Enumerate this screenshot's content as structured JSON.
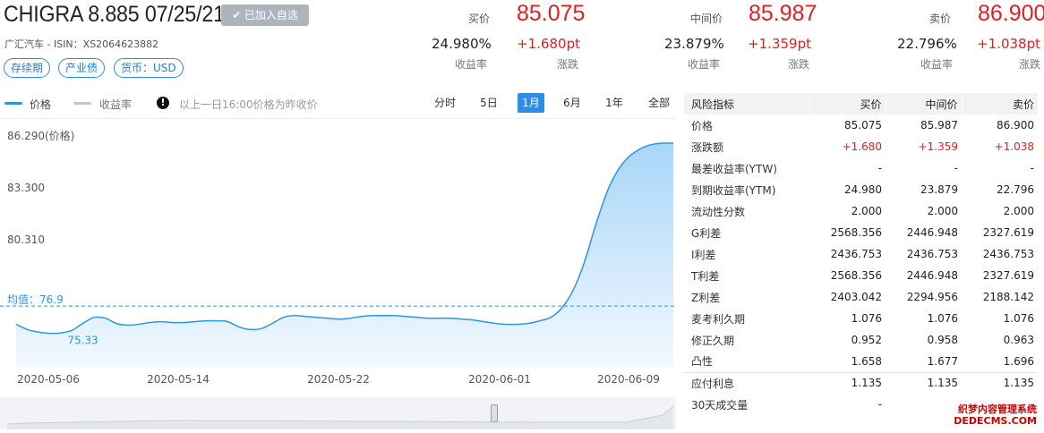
{
  "header": {
    "title": "CHIGRA 8.885 07/25/21",
    "watch_label": "✔ 已加入自选",
    "subline": "广汇汽车 - ISIN：XS2064623882",
    "tags": [
      "存续期",
      "产业债",
      "货币：USD"
    ]
  },
  "quotes": {
    "bid": {
      "label": "买价",
      "price": "85.075",
      "yield": "24.980%",
      "yield_label": "收益率",
      "change": "+1.680pt",
      "change_label": "涨跌"
    },
    "mid": {
      "label": "中间价",
      "price": "85.987",
      "yield": "23.879%",
      "yield_label": "收益率",
      "change": "+1.359pt",
      "change_label": "涨跌"
    },
    "ask": {
      "label": "卖价",
      "price": "86.900",
      "yield": "22.796%",
      "yield_label": "收益率",
      "change": "+1.038pt",
      "change_label": "涨跌"
    }
  },
  "toolbar": {
    "legend_price": "价格",
    "legend_yield": "收益率",
    "note": "以上一日16:00价格为昨收价",
    "ranges": [
      "分时",
      "5日",
      "1月",
      "6月",
      "1年",
      "全部"
    ],
    "active_range": "1月"
  },
  "chart_data": {
    "type": "area",
    "title": "",
    "ylabel": "86.290(价格)",
    "y_ticks": [
      "86.290(价格)",
      "83.300",
      "80.310"
    ],
    "ylim": [
      73.4,
      86.29
    ],
    "x_ticks": [
      "2020-05-06",
      "2020-05-14",
      "2020-05-22",
      "2020-06-01",
      "2020-06-09"
    ],
    "mean_label": "均值：76.9",
    "mean_value": 76.9,
    "min_label": "75.33",
    "min_value": 75.33,
    "series": [
      {
        "values": [
          75.85,
          75.55,
          75.4,
          75.33,
          75.35,
          75.5,
          75.9,
          76.25,
          76.2,
          75.9,
          75.8,
          75.85,
          75.95,
          76.0,
          75.95,
          75.95,
          76.0,
          76.05,
          76.05,
          76.0,
          75.7,
          75.55,
          75.6,
          75.9,
          76.25,
          76.35,
          76.3,
          76.25,
          76.2,
          76.15,
          76.2,
          76.3,
          76.35,
          76.35,
          76.35,
          76.3,
          76.25,
          76.2,
          76.2,
          76.2,
          76.15,
          76.1,
          76.0,
          75.9,
          75.85,
          75.85,
          75.9,
          76.05,
          76.25,
          76.8,
          77.8,
          79.4,
          81.5,
          83.4,
          84.7,
          85.5,
          85.95,
          86.2,
          86.29,
          86.29
        ]
      }
    ],
    "colors": {
      "line": "#2c95e6",
      "fill_top": "#a9d6f7",
      "fill_bottom": "#f2f9ff",
      "mean": "#2c95e6",
      "tick": "#555"
    },
    "grid": false
  },
  "table": {
    "headers": [
      "风险指标",
      "买价",
      "中间价",
      "卖价"
    ],
    "rows": [
      {
        "label": "价格",
        "bid": "85.075",
        "mid": "85.987",
        "ask": "86.900",
        "red": false
      },
      {
        "label": "涨跌额",
        "bid": "+1.680",
        "mid": "+1.359",
        "ask": "+1.038",
        "red": true
      },
      {
        "label": "最差收益率(YTW)",
        "bid": "-",
        "mid": "-",
        "ask": "-",
        "red": false
      },
      {
        "label": "到期收益率(YTM)",
        "bid": "24.980",
        "mid": "23.879",
        "ask": "22.796",
        "red": false
      },
      {
        "label": "流动性分数",
        "bid": "2.000",
        "mid": "2.000",
        "ask": "2.000",
        "red": false
      },
      {
        "label": "G利差",
        "bid": "2568.356",
        "mid": "2446.948",
        "ask": "2327.619",
        "red": false
      },
      {
        "label": "I利差",
        "bid": "2436.753",
        "mid": "2436.753",
        "ask": "2436.753",
        "red": false
      },
      {
        "label": "T利差",
        "bid": "2568.356",
        "mid": "2446.948",
        "ask": "2327.619",
        "red": false
      },
      {
        "label": "Z利差",
        "bid": "2403.042",
        "mid": "2294.956",
        "ask": "2188.142",
        "red": false
      },
      {
        "label": "麦考利久期",
        "bid": "1.076",
        "mid": "1.076",
        "ask": "1.076",
        "red": false
      },
      {
        "label": "修正久期",
        "bid": "0.952",
        "mid": "0.958",
        "ask": "0.963",
        "red": false
      },
      {
        "label": "凸性",
        "bid": "1.658",
        "mid": "1.677",
        "ask": "1.696",
        "red": false
      },
      {
        "label": "应付利息",
        "bid": "1.135",
        "mid": "1.135",
        "ask": "1.135",
        "red": false
      },
      {
        "label": "30天成交量",
        "bid": "-",
        "mid": "",
        "ask": "-",
        "red": false
      }
    ]
  },
  "watermark": {
    "line1": "织梦内容管理系统",
    "line2": "DEDECMS.COM"
  }
}
